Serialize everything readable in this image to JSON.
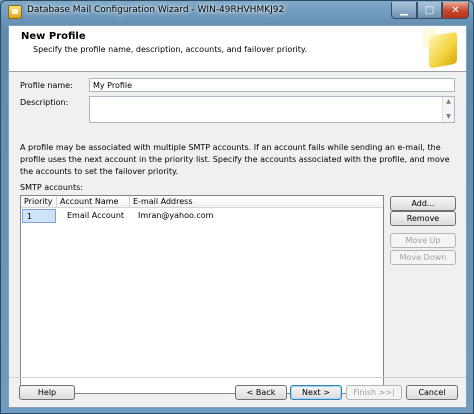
{
  "window": {
    "title": "Database Mail Configuration Wizard - WIN-49RHVHMKJ92",
    "minimize_glyph": "▁",
    "maximize_glyph": "□",
    "close_glyph": "✕"
  },
  "header": {
    "title": "New Profile",
    "subtitle": "Specify the profile name, description, accounts, and failover priority."
  },
  "form": {
    "profile_name_label": "Profile name:",
    "profile_name_value": "My Profile",
    "description_label": "Description:",
    "description_value": ""
  },
  "info_text": "A profile may be associated with multiple SMTP accounts. If an account fails while sending an e-mail, the profile uses the next account in the priority list. Specify the accounts associated with the profile, and move the accounts to set the failover priority.",
  "smtp": {
    "label": "SMTP accounts:",
    "columns": [
      "Priority",
      "Account Name",
      "E-mail Address"
    ],
    "rows": [
      {
        "priority": "1",
        "account_name": "Email Account",
        "email": "Imran@yahoo.com"
      }
    ]
  },
  "side_buttons": {
    "add": "Add...",
    "remove": "Remove",
    "move_up": "Move Up",
    "move_down": "Move Down"
  },
  "footer_buttons": {
    "help": "Help",
    "back": "< Back",
    "next": "Next >",
    "finish": "Finish >>|",
    "cancel": "Cancel"
  },
  "icons": {
    "app": "mail-wizard-icon",
    "header": "mail-envelope-graphic"
  },
  "colors": {
    "selection": "#cfe3f7",
    "close_button": "#c4482c"
  }
}
